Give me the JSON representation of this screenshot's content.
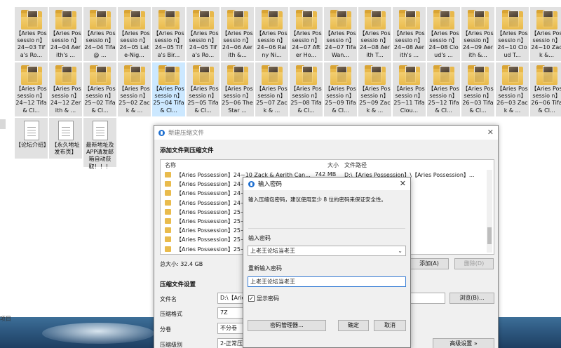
{
  "desktop": {
    "folders_row1": [
      {
        "label": "【Aries Possessio n】24~03 Tifa's Ro..."
      },
      {
        "label": "【Aries Possessio n】24~04 Aerith's ..."
      },
      {
        "label": "【Aries Possessio n】24~04 Tifa @ ..."
      },
      {
        "label": "【Aries Possessio n】24~05 Late-Nig..."
      },
      {
        "label": "【Aries Possessio n】24~05 Tifa's Bir..."
      },
      {
        "label": "【Aries Possessio n】24~05 Tifa's Ro..."
      },
      {
        "label": "【Aries Possessio n】24~06 Aerith &..."
      },
      {
        "label": "【Aries Possessio n】24~06 Rainy Ni..."
      },
      {
        "label": "【Aries Possessio n】24~07 After Ho..."
      },
      {
        "label": "【Aries Possessio n】24~07 Tifa Wan..."
      },
      {
        "label": "【Aries Possessio n】24~08 Aerith T..."
      },
      {
        "label": "【Aries Possessio n】24~08 Aerith's ..."
      },
      {
        "label": "【Aries Possessio n】24~08 Cloud's ..."
      },
      {
        "label": "【Aries Possessio n】24~09 Aerith &..."
      },
      {
        "label": "【Aries Possessio n】24~10 Cloud T..."
      },
      {
        "label": "【Aries Possessio n】24~10 Zack &..."
      }
    ],
    "folders_row2": [
      {
        "label": "【Aries Possessio n】24~12 Tifa & Cl..."
      },
      {
        "label": "【Aries Possessio n】24~12 Zerith & ..."
      },
      {
        "label": "【Aries Possessio n】25~02 Tifa & Cl..."
      },
      {
        "label": "【Aries Possessio n】25~02 Zack & ..."
      },
      {
        "label": "【Aries Possessio n】25~04 Tifa & Cl..."
      },
      {
        "label": "【Aries Possessio n】25~05 Tifa & Cl..."
      },
      {
        "label": "【Aries Possessio n】25~06 The Star ..."
      },
      {
        "label": "【Aries Possessio n】25~07 Zack & ..."
      },
      {
        "label": "【Aries Possessio n】25~08 Tifa & Cl..."
      },
      {
        "label": "【Aries Possessio n】25~09 Tifa & Cl..."
      },
      {
        "label": "【Aries Possessio n】25~09 Zack & ..."
      },
      {
        "label": "【Aries Possessio n】25~11 Tifa Clou..."
      },
      {
        "label": "【Aries Possessio n】25~12 Tifa & Cl..."
      },
      {
        "label": "【Aries Possessio n】26~03 Tifa & Cl..."
      },
      {
        "label": "【Aries Possessio n】26~03 Zack & ..."
      },
      {
        "label": "【Aries Possessio n】26~06 Tifa & Cl..."
      }
    ],
    "documents": [
      {
        "label": "【论坛介绍】"
      },
      {
        "label": "【永久地址发布页】"
      },
      {
        "label": "最新地址及APP请发邮箱自动获取！！！"
      }
    ],
    "edge_label": "项目"
  },
  "archive_dialog": {
    "title": "新建压缩文件",
    "section_add": "添加文件到压缩文件",
    "col_name": "名称",
    "col_size": "大小",
    "col_path": "文件路径",
    "rows": [
      {
        "name": "【Aries Possession】24~10 Zack & Aerith Can...",
        "size": "742 MB",
        "path": "D:\\【Aries Possession】\\【Aries Possession】..."
      },
      {
        "name": "【Aries Possession】24~11 T",
        "size": "",
        "path": "【Aries Possession】..."
      },
      {
        "name": "【Aries Possession】24~12 T",
        "size": "",
        "path": "【Aries Possession】..."
      },
      {
        "name": "【Aries Possession】24~12 Z",
        "size": "",
        "path": "【Aries Possession】..."
      },
      {
        "name": "【Aries Possession】25~02 T",
        "size": "",
        "path": "【Aries Possession】..."
      },
      {
        "name": "【Aries Possession】25~02 Z",
        "size": "",
        "path": "【Aries Possession】..."
      },
      {
        "name": "【Aries Possession】25~04 T",
        "size": "",
        "path": "【Aries Possession】..."
      },
      {
        "name": "【Aries Possession】25~05 T",
        "size": "",
        "path": "【Aries Possession】..."
      },
      {
        "name": "【Aries Possession】25~06 T",
        "size": "",
        "path": "【Aries Possession】..."
      }
    ],
    "total_size": "总大小: 32.4 GB",
    "add_button": "添加(A)",
    "delete_button": "删除(D)",
    "section_settings": "压缩文件设置",
    "filename_label": "文件名",
    "filename_value": "D:\\【Arie",
    "browse_button": "浏览(B)...",
    "format_label": "压缩格式",
    "format_value": "7Z",
    "split_label": "分卷",
    "split_value": "不分卷",
    "level_label": "压缩级别",
    "level_value": "2-正常压缩",
    "advanced_button": "高级设置 »"
  },
  "password_dialog": {
    "title": "输入密码",
    "hint": "输入压缩包密码，建议使用至少 8 位的密码来保证安全性。",
    "enter_label": "输入密码",
    "enter_value": "上老王论坛当老王",
    "reenter_label": "重新输入密码",
    "reenter_value": "上老王论坛当老王",
    "show_password": "显示密码",
    "show_checked": "✓",
    "manager_button": "密码管理器...",
    "ok_button": "确定",
    "cancel_button": "取消"
  },
  "colors": {
    "selected_tile": "#cce8ff",
    "tile": "#e1e1e1",
    "accent": "#1e6fd0"
  }
}
